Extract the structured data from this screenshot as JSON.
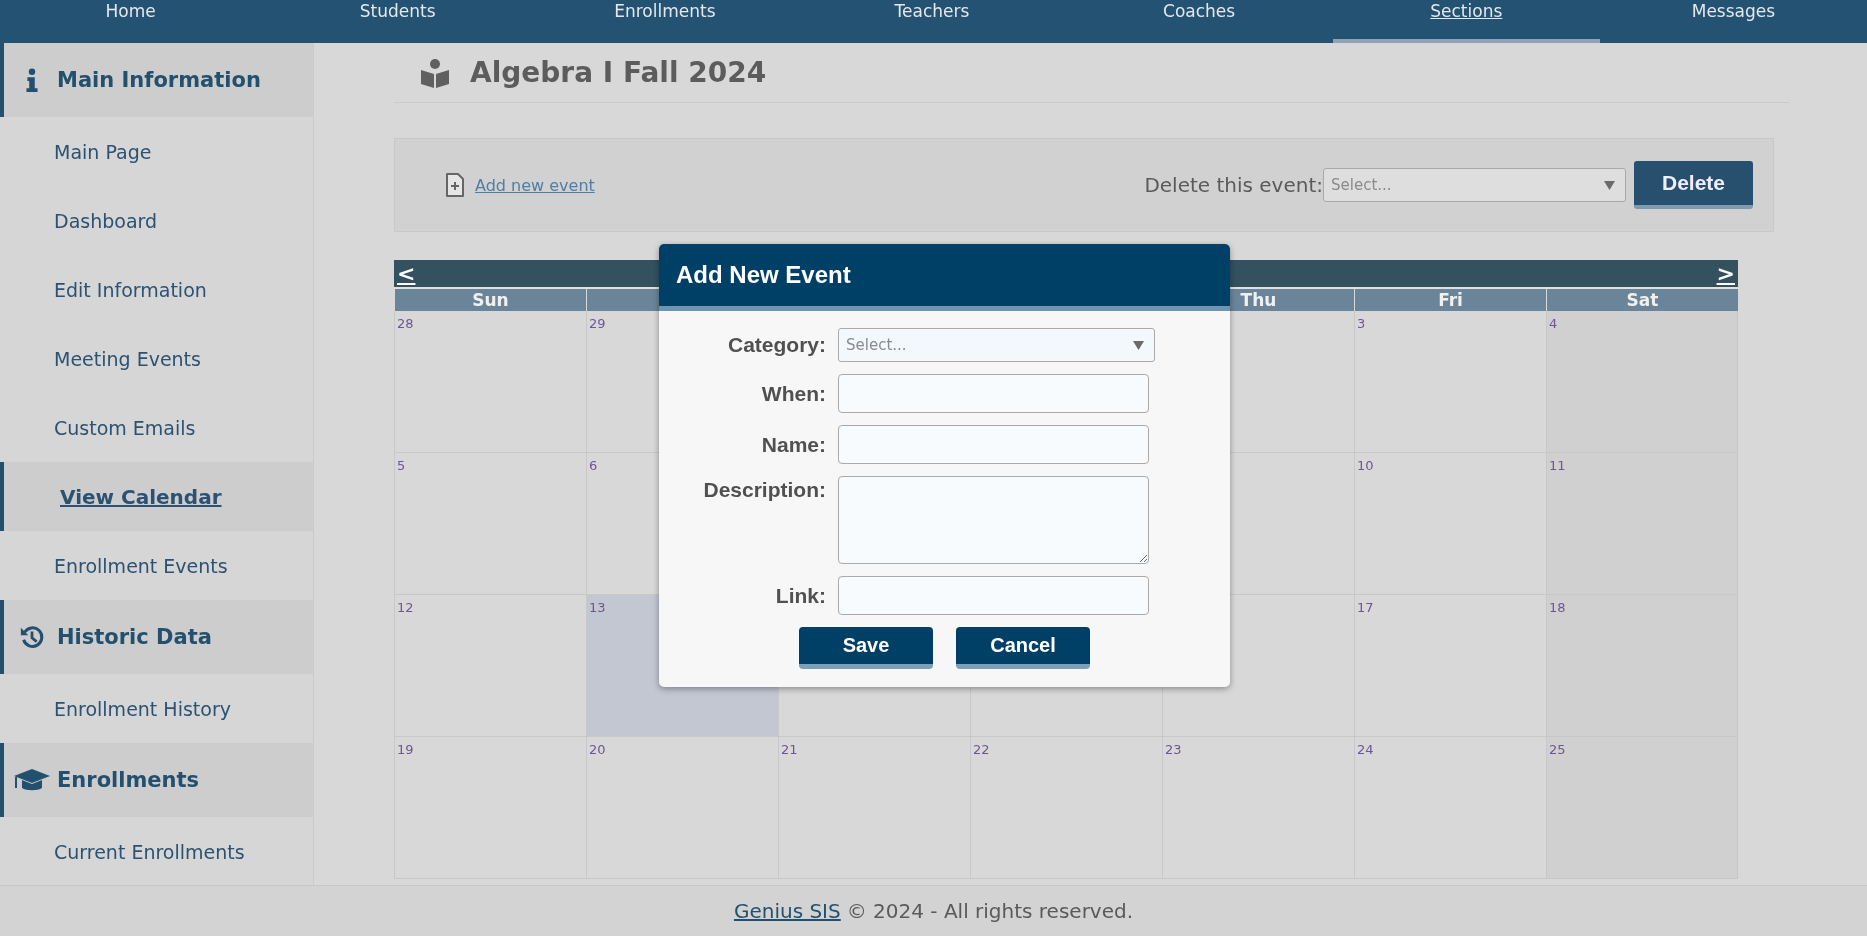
{
  "nav": [
    {
      "label": "Home",
      "selected": false
    },
    {
      "label": "Students",
      "selected": false
    },
    {
      "label": "Enrollments",
      "selected": false
    },
    {
      "label": "Teachers",
      "selected": false
    },
    {
      "label": "Coaches",
      "selected": false
    },
    {
      "label": "Sections",
      "selected": true
    },
    {
      "label": "Messages",
      "selected": false
    }
  ],
  "sidebar": {
    "sections": [
      {
        "kind": "info",
        "title": "Main Information",
        "items": [
          {
            "label": "Main Page",
            "selected": false
          },
          {
            "label": "Dashboard",
            "selected": false
          },
          {
            "label": "Edit Information",
            "selected": false
          },
          {
            "label": "Meeting Events",
            "selected": false
          },
          {
            "label": "Custom Emails",
            "selected": false
          },
          {
            "label": "View Calendar",
            "selected": true
          },
          {
            "label": "Enrollment Events",
            "selected": false
          }
        ]
      },
      {
        "kind": "history",
        "title": "Historic Data",
        "items": [
          {
            "label": "Enrollment History",
            "selected": false
          }
        ]
      },
      {
        "kind": "enrollments",
        "title": "Enrollments",
        "items": [
          {
            "label": "Current Enrollments",
            "selected": false
          }
        ]
      }
    ]
  },
  "page": {
    "title": "Algebra I Fall 2024"
  },
  "toolbar": {
    "add_link": "Add new event",
    "delete_label": "Delete this event:",
    "delete_select": {
      "placeholder": "Select..."
    },
    "delete_button": "Delete"
  },
  "calendar": {
    "prev": "<",
    "next": ">",
    "weekdays": {
      "sun": "Sun",
      "thu": "Thu",
      "fri": "Fri",
      "sat": "Sat"
    },
    "weeks": [
      {
        "sun": {
          "day": "28",
          "today": false
        },
        "mon": {
          "day": "29",
          "today": false
        },
        "fri": {
          "day": "3",
          "today": false
        },
        "sat": {
          "day": "4",
          "today": false
        }
      },
      {
        "sun": {
          "day": "5",
          "today": false
        },
        "mon": {
          "day": "6",
          "today": false
        },
        "fri": {
          "day": "10",
          "today": false
        },
        "sat": {
          "day": "11",
          "today": false
        }
      },
      {
        "sun": {
          "day": "12",
          "today": false
        },
        "mon": {
          "day": "13",
          "today": true
        },
        "tue": {
          "today": false
        },
        "wed": {
          "today": false
        },
        "thu": {
          "today": false
        },
        "fri": {
          "day": "17",
          "today": false
        },
        "sat": {
          "day": "18",
          "today": false
        }
      },
      {
        "sun": {
          "day": "19",
          "today": false
        },
        "mon": {
          "day": "20",
          "today": false
        },
        "tue": {
          "day": "21",
          "today": false
        },
        "wed": {
          "day": "22",
          "today": false
        },
        "thu": {
          "day": "23",
          "today": false
        },
        "fri": {
          "day": "24",
          "today": false
        },
        "sat": {
          "day": "25",
          "today": false
        }
      }
    ]
  },
  "dialog": {
    "title": "Add New Event",
    "fields": [
      {
        "kind": "select",
        "label": "Category:",
        "placeholder": "Select..."
      },
      {
        "kind": "text",
        "label": "When:"
      },
      {
        "kind": "text",
        "label": "Name:"
      },
      {
        "kind": "textarea",
        "label": "Description:"
      },
      {
        "kind": "text",
        "label": "Link:"
      }
    ],
    "buttons": [
      "Save",
      "Cancel"
    ]
  },
  "footer": {
    "link": "Genius SIS",
    "text": "© 2024 - All rights reserved."
  }
}
